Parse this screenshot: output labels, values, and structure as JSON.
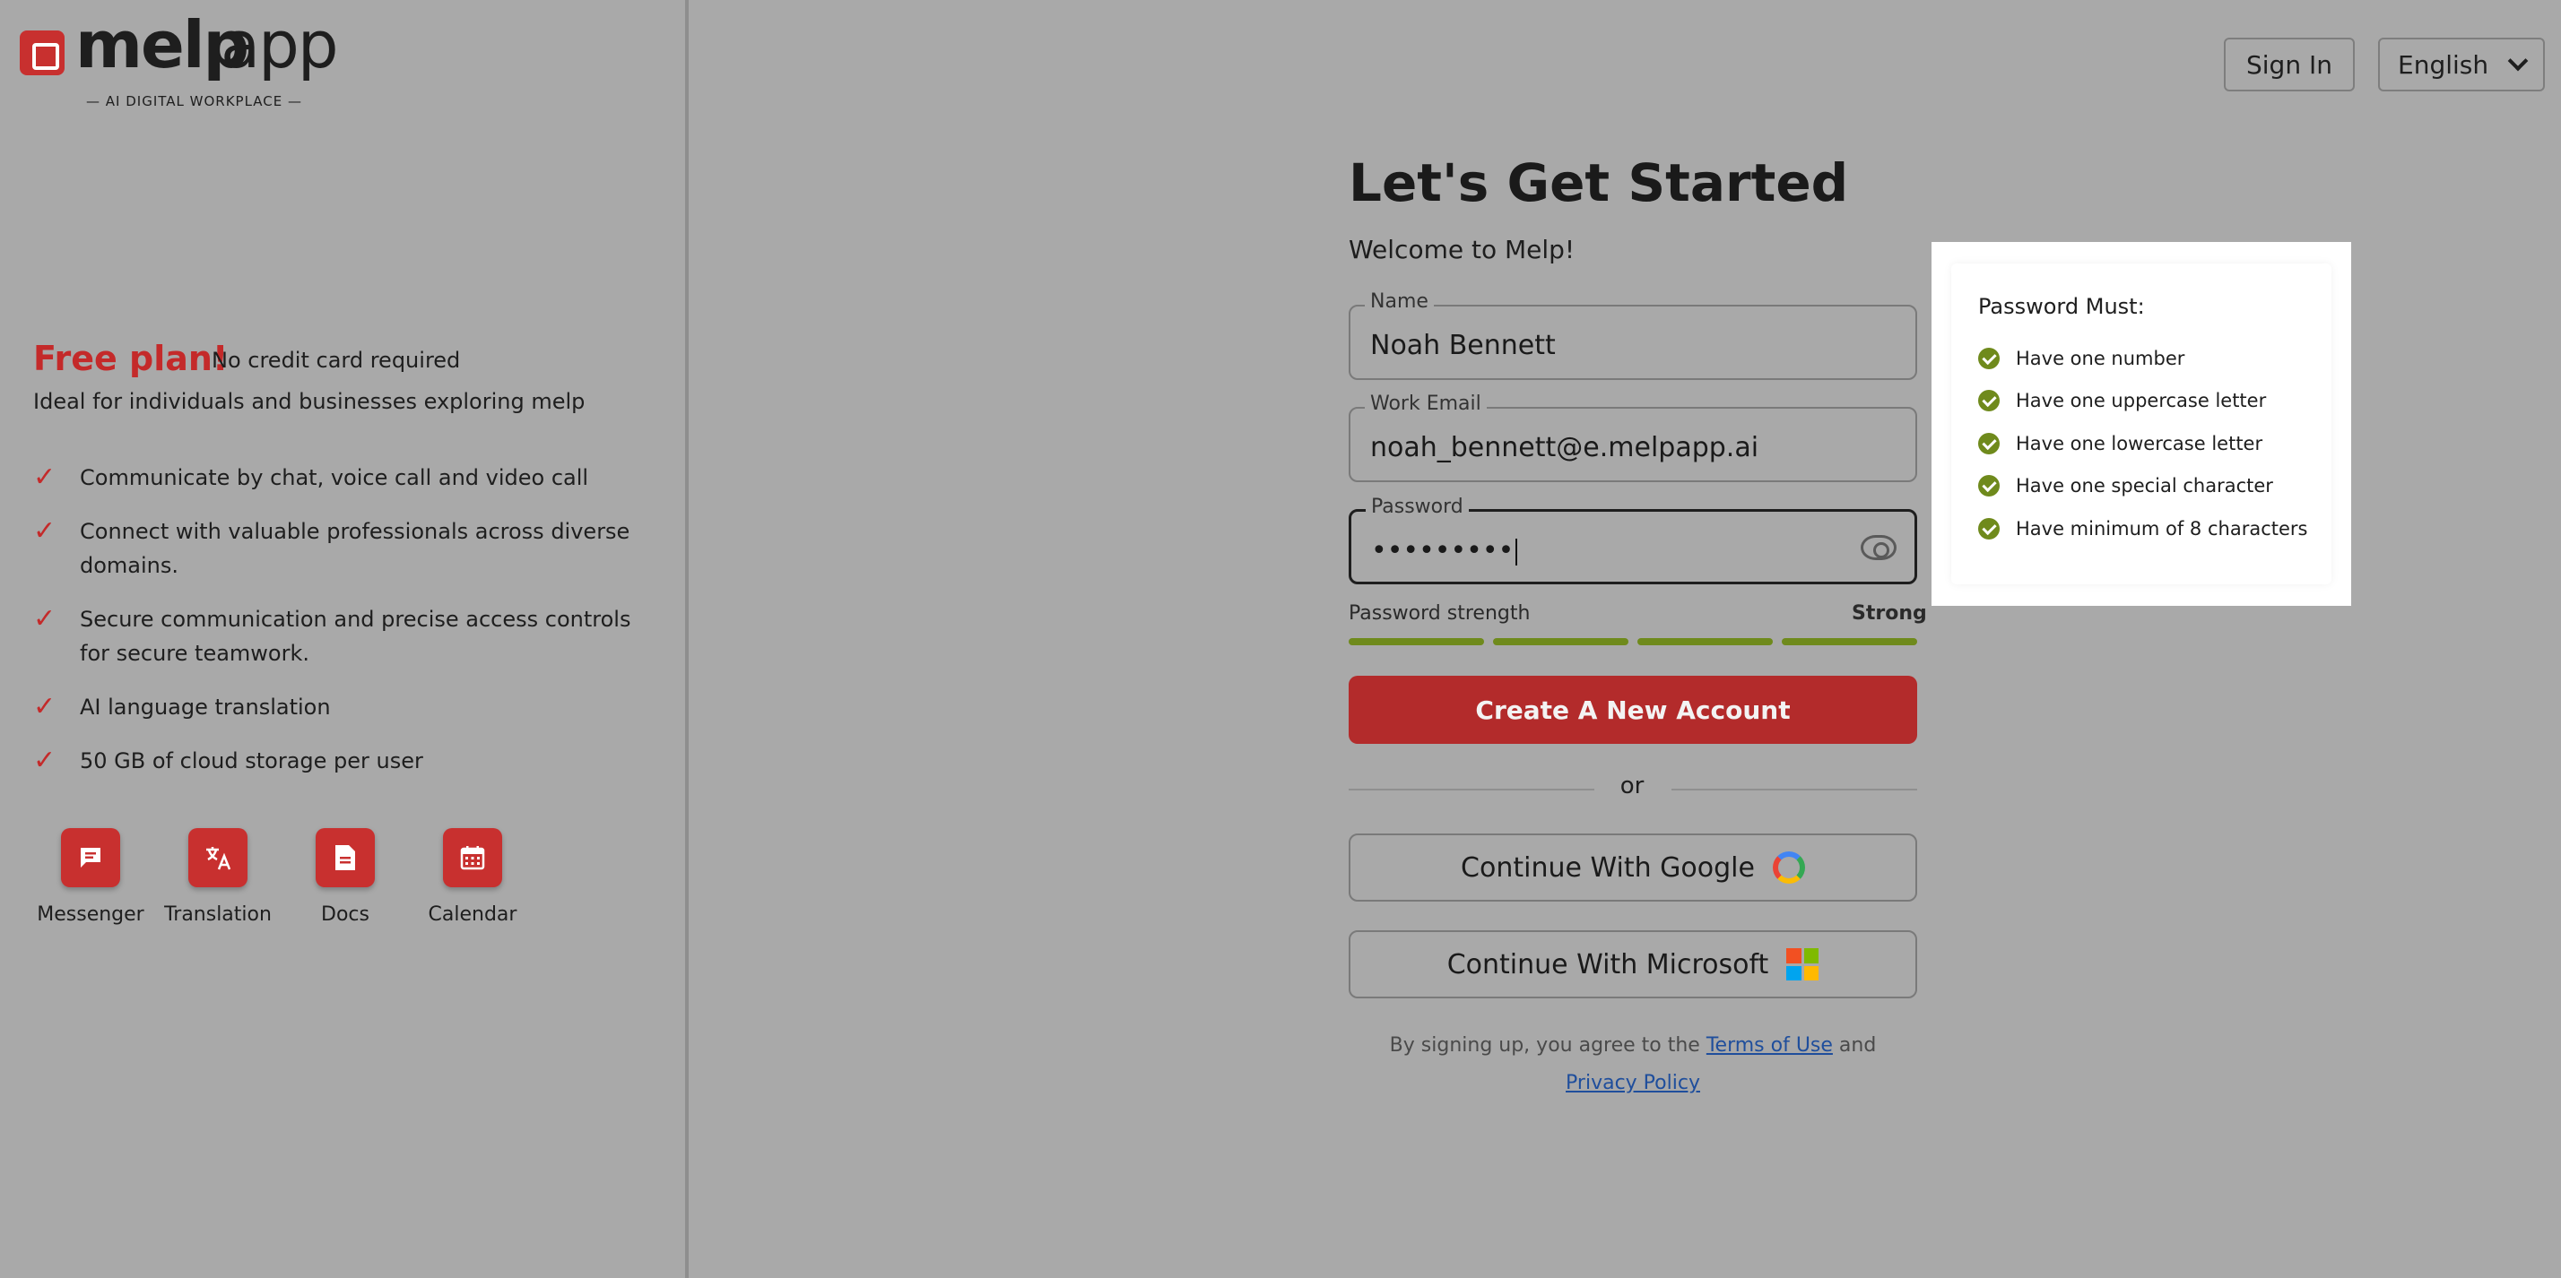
{
  "brand": {
    "name_bold": "melp",
    "name_light": "app",
    "tagline": "— AI DIGITAL WORKPLACE —"
  },
  "left": {
    "free_plan": "Free plan!",
    "no_credit": "No credit card required",
    "ideal": "Ideal for individuals and businesses exploring melp",
    "features": [
      "Communicate by chat, voice call and video call",
      "Connect with valuable professionals across diverse domains.",
      "Secure communication and precise access controls for secure teamwork.",
      "AI language translation",
      "50 GB of cloud storage per user"
    ],
    "apps": [
      {
        "label": "Messenger",
        "icon": "chat-icon"
      },
      {
        "label": "Translation",
        "icon": "translate-icon"
      },
      {
        "label": "Docs",
        "icon": "doc-icon"
      },
      {
        "label": "Calendar",
        "icon": "calendar-icon"
      }
    ]
  },
  "header": {
    "sign_in": "Sign In",
    "language": "English"
  },
  "form": {
    "title": "Let's Get Started",
    "subtitle": "Welcome to Melp!",
    "name_label": "Name",
    "name_value": "Noah Bennett",
    "email_label": "Work Email",
    "email_value": "noah_bennett@e.melpapp.ai",
    "password_label": "Password",
    "password_value": "•••••••••",
    "strength_label": "Password strength",
    "strength_value": "Strong",
    "strength_level": 1.0,
    "create_button": "Create A New Account",
    "or": "or",
    "google_button": "Continue With Google",
    "microsoft_button": "Continue With Microsoft",
    "terms_prefix": "By signing up, you agree to the",
    "terms_link": "Terms of Use",
    "terms_and": "and",
    "privacy_link": "Privacy Policy"
  },
  "password_rules": {
    "title": "Password Must:",
    "items": [
      "Have one number",
      "Have one uppercase letter",
      "Have one lowercase letter",
      "Have one special character",
      "Have minimum of 8 characters"
    ]
  },
  "colors": {
    "brand_red": "#c8302f",
    "button_red": "#b32b2b",
    "strength_green": "#6f8a1c",
    "link_blue": "#1f4e9c"
  }
}
